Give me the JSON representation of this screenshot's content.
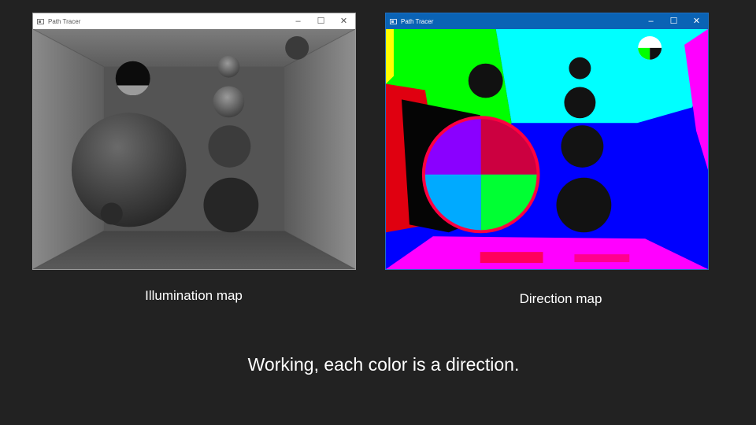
{
  "windows": {
    "left": {
      "title": "Path Tracer",
      "controls": {
        "minimize": "–",
        "maximize": "☐",
        "close": "✕"
      }
    },
    "right": {
      "title": "Path Tracer",
      "controls": {
        "minimize": "–",
        "maximize": "☐",
        "close": "✕"
      }
    }
  },
  "captions": {
    "illumination": "Illumination map",
    "direction": "Direction map"
  },
  "subtitle": "Working, each color is a direction.",
  "colors": {
    "background": "#222222",
    "active_titlebar": "#0a63b5",
    "inactive_titlebar": "#ffffff"
  }
}
